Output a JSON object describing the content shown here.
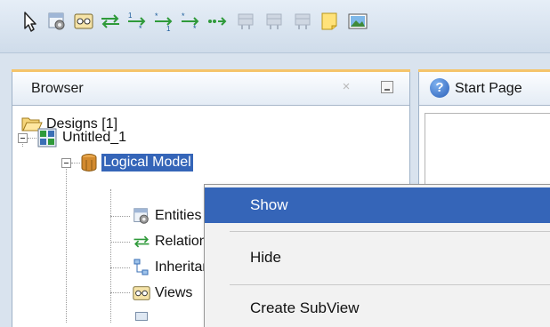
{
  "toolbar": {
    "buttons": [
      {
        "name": "select-pointer-icon"
      },
      {
        "name": "new-entity-icon"
      },
      {
        "name": "new-view-icon"
      },
      {
        "name": "new-relation-1-1-icon"
      },
      {
        "name": "new-relation-1-n-icon"
      },
      {
        "name": "new-relation-n-1-icon"
      },
      {
        "name": "new-relation-n-m-icon"
      },
      {
        "name": "new-arc-icon"
      },
      {
        "name": "table-disabled-icon"
      },
      {
        "name": "table-disabled-2-icon"
      },
      {
        "name": "table-disabled-3-icon"
      },
      {
        "name": "note-icon"
      },
      {
        "name": "picture-icon"
      }
    ]
  },
  "browser": {
    "title": "Browser",
    "close_glyph": "×",
    "tree": {
      "designs": "Designs [1]",
      "design_name": "Untitled_1",
      "logical_model": "Logical Model",
      "children": [
        "Entities",
        "Relations",
        "Inheritances",
        "Views"
      ]
    }
  },
  "start_page": {
    "icon_glyph": "?",
    "tab_label": "Start Page"
  },
  "context_menu": {
    "items": [
      "Show",
      "Hide",
      "Create SubView"
    ],
    "active_item": "Show"
  },
  "colors": {
    "selection": "#3565b8",
    "panel_accent": "#f5c46a",
    "background": "#d9e3ee"
  }
}
